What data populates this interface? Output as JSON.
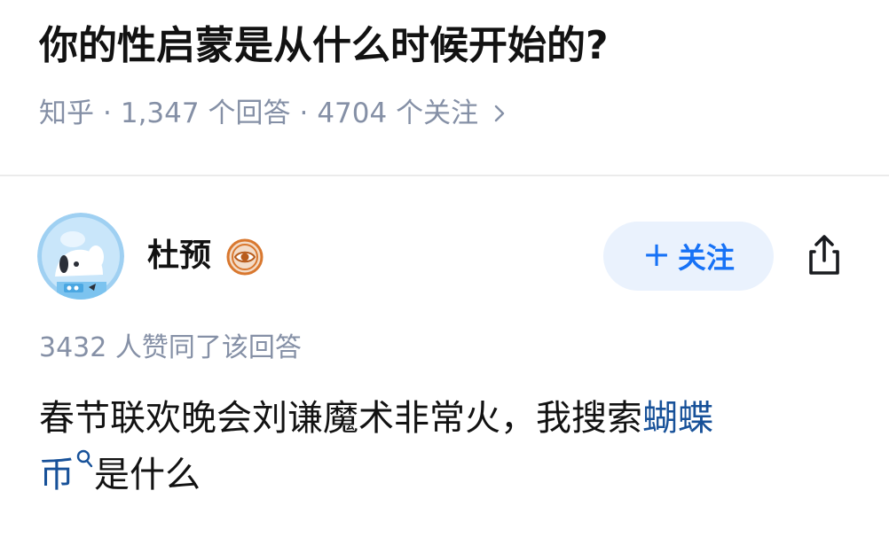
{
  "question": {
    "title": "你的性启蒙是从什么时候开始的?",
    "source": "知乎",
    "answers_count": "1,347 个回答",
    "followers_count": "4704 个关注",
    "separator": "·"
  },
  "author": {
    "name": "杜预",
    "avatar_icon": "astronaut-dog-avatar",
    "badge_icon": "eye-badge-icon"
  },
  "follow_button": {
    "plus": "+",
    "label": "关注"
  },
  "share": {
    "icon": "share-icon"
  },
  "answer": {
    "vote_text": "3432 人赞同了该回答",
    "line1_text": "春节联欢晚会刘谦魔术非常火，我搜索",
    "link_part1": "蝴蝶",
    "link_part2": "币",
    "line2_rest": "是什么"
  },
  "colors": {
    "title": "#121212",
    "meta": "#8590a6",
    "follow_bg": "#eaf2fd",
    "follow_text": "#1772f6",
    "link": "#175199",
    "divider": "#ebebeb"
  }
}
